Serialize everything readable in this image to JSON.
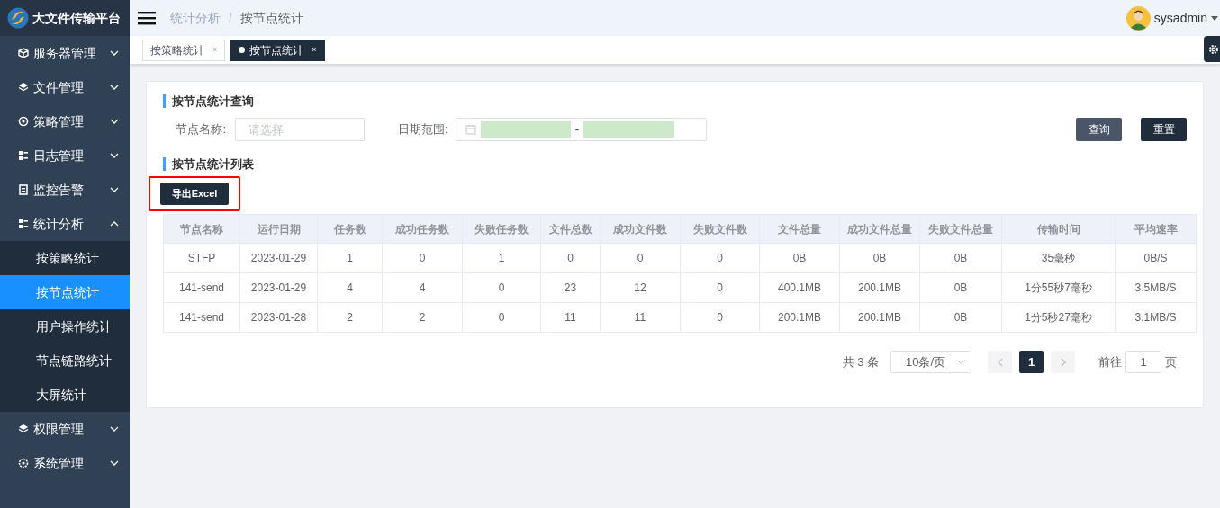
{
  "app_title": "大文件传输平台",
  "sidebar": {
    "items": [
      {
        "label": "服务器管理",
        "expanded": false
      },
      {
        "label": "文件管理",
        "expanded": false
      },
      {
        "label": "策略管理",
        "expanded": false
      },
      {
        "label": "日志管理",
        "expanded": false
      },
      {
        "label": "监控告警",
        "expanded": false
      },
      {
        "label": "统计分析",
        "expanded": true,
        "children": [
          {
            "label": "按策略统计",
            "selected": false
          },
          {
            "label": "按节点统计",
            "selected": true
          },
          {
            "label": "用户操作统计",
            "selected": false
          },
          {
            "label": "节点链路统计",
            "selected": false
          },
          {
            "label": "大屏统计",
            "selected": false
          }
        ]
      },
      {
        "label": "权限管理",
        "expanded": false
      },
      {
        "label": "系统管理",
        "expanded": false
      }
    ]
  },
  "breadcrumb": {
    "items": [
      "统计分析",
      "按节点统计"
    ],
    "separator": "/"
  },
  "user": {
    "name": "sysadmin"
  },
  "tabs": [
    {
      "label": "按策略统计",
      "close": "×",
      "selected": false
    },
    {
      "label": "按节点统计",
      "close": "×",
      "selected": true
    }
  ],
  "query": {
    "title": "按节点统计查询",
    "node_label": "节点名称:",
    "node_placeholder": "请选择",
    "date_label": "日期范围:",
    "date_separator": "-",
    "search_button": "查询",
    "reset_button": "重置"
  },
  "list": {
    "title": "按节点统计列表",
    "export_button": "导出Excel",
    "export_highlighted": true
  },
  "table": {
    "columns": [
      "节点名称",
      "运行日期",
      "任务数",
      "成功任务数",
      "失败任务数",
      "文件总数",
      "成功文件数",
      "失败文件数",
      "文件总量",
      "成功文件总量",
      "失败文件总量",
      "传输时间",
      "平均速率"
    ],
    "rows": [
      [
        "STFP",
        "2023-01-29",
        "1",
        "0",
        "1",
        "0",
        "0",
        "0",
        "0B",
        "0B",
        "0B",
        "35毫秒",
        "0B/S"
      ],
      [
        "141-send",
        "2023-01-29",
        "4",
        "4",
        "0",
        "23",
        "12",
        "0",
        "400.1MB",
        "200.1MB",
        "0B",
        "1分55秒7毫秒",
        "3.5MB/S"
      ],
      [
        "141-send",
        "2023-01-28",
        "2",
        "2",
        "0",
        "11",
        "11",
        "0",
        "200.1MB",
        "200.1MB",
        "0B",
        "1分5秒27毫秒",
        "3.1MB/S"
      ]
    ]
  },
  "pagination": {
    "total": "共 3 条",
    "page_size": "10条/页",
    "pages": [
      {
        "label": "1",
        "selected": true
      }
    ],
    "goto_label": "前往",
    "goto_value": "1",
    "page_suffix": "页"
  }
}
